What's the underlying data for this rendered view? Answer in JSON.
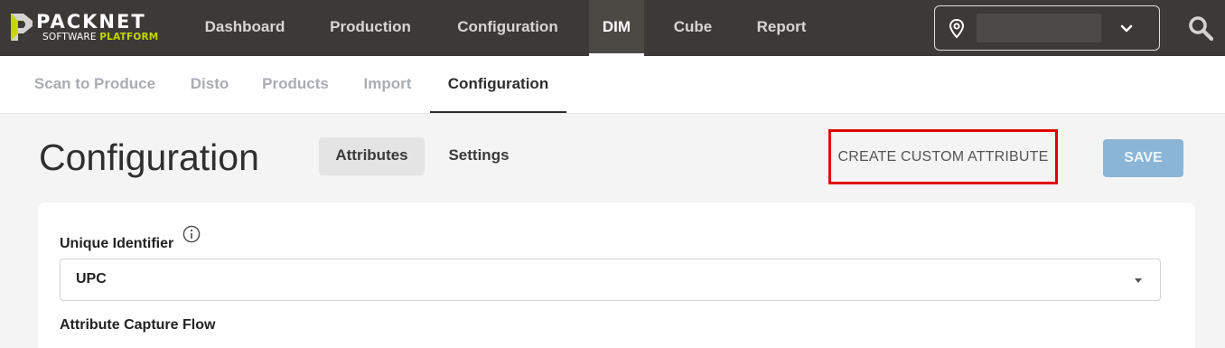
{
  "brand": {
    "name": "PACKNET",
    "sub_prefix": "SOFTWARE",
    "sub_highlight": "PLATFORM",
    "accent_color": "#c3d600"
  },
  "nav": {
    "items": [
      {
        "label": "Dashboard"
      },
      {
        "label": "Production"
      },
      {
        "label": "Configuration"
      },
      {
        "label": "DIM",
        "active": true
      },
      {
        "label": "Cube"
      },
      {
        "label": "Report"
      }
    ],
    "site_select": {
      "icon": "map-pin-icon",
      "value": "",
      "caret": "chevron-down-icon"
    },
    "search_icon": "search-icon"
  },
  "subnav": {
    "items": [
      {
        "label": "Scan to Produce"
      },
      {
        "label": "Disto"
      },
      {
        "label": "Products"
      },
      {
        "label": "Import"
      },
      {
        "label": "Configuration",
        "active": true
      }
    ]
  },
  "page": {
    "title": "Configuration",
    "tabs": [
      {
        "label": "Attributes",
        "active": true
      },
      {
        "label": "Settings"
      }
    ],
    "create_button": "CREATE CUSTOM ATTRIBUTE",
    "save_button": "SAVE",
    "save_color": "#8ab5d6",
    "highlight_color": "#e00000"
  },
  "form": {
    "unique_identifier_label": "Unique Identifier",
    "unique_identifier_value": "UPC",
    "capture_flow_label": "Attribute Capture Flow"
  }
}
